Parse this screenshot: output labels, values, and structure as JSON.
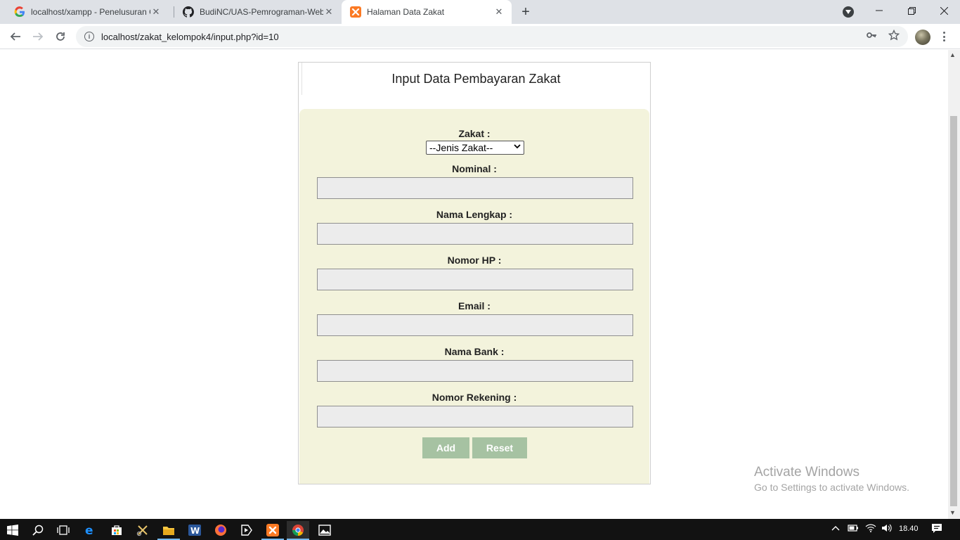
{
  "browser": {
    "tabs": [
      {
        "title": "localhost/xampp - Penelusuran G",
        "favicon": "google-icon"
      },
      {
        "title": "BudiNC/UAS-Pemrograman-Web",
        "favicon": "github-icon"
      },
      {
        "title": "Halaman Data Zakat",
        "favicon": "xampp-icon",
        "active": true
      }
    ],
    "url": "localhost/zakat_kelompok4/input.php?id=10"
  },
  "form": {
    "title": "Input Data Pembayaran Zakat",
    "zakat_label": "Zakat :",
    "zakat_selected": "--Jenis Zakat--",
    "nominal_label": "Nominal :",
    "nama_lengkap_label": "Nama Lengkap :",
    "nomor_hp_label": "Nomor HP :",
    "email_label": "Email :",
    "nama_bank_label": "Nama Bank :",
    "nomor_rekening_label": "Nomor Rekening :",
    "add_label": "Add",
    "reset_label": "Reset",
    "field_values": {
      "nominal": "",
      "nama_lengkap": "",
      "nomor_hp": "",
      "email": "",
      "nama_bank": "",
      "nomor_rekening": ""
    }
  },
  "watermark": {
    "line1": "Activate Windows",
    "line2": "Go to Settings to activate Windows."
  },
  "taskbar": {
    "clock": "18.40"
  },
  "colors": {
    "form_bg": "#f3f3dc",
    "button_bg": "#a6c2a2",
    "input_bg": "#ececec"
  }
}
